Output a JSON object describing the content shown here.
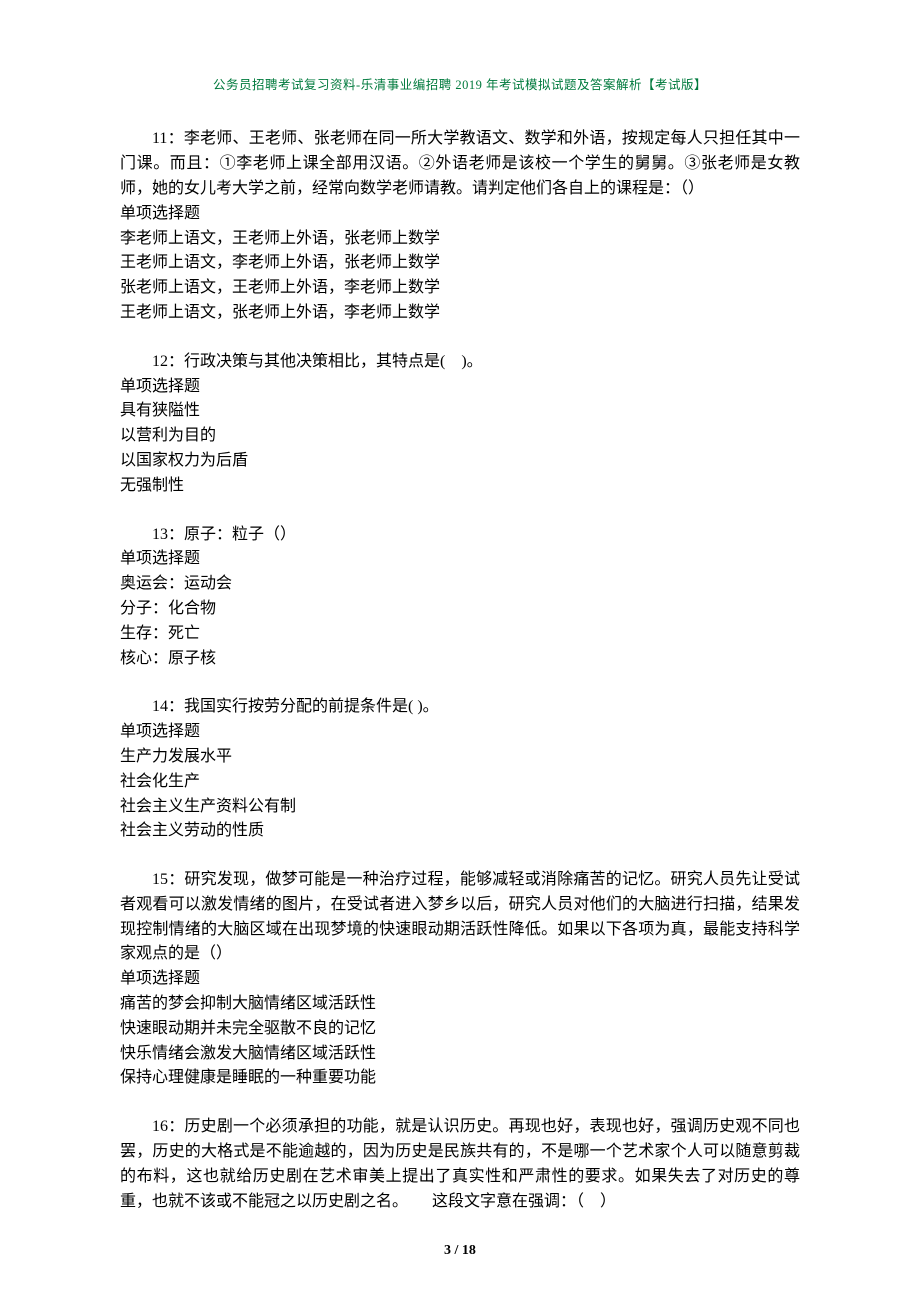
{
  "header": "公务员招聘考试复习资料-乐清事业编招聘 2019 年考试模拟试题及答案解析【考试版】",
  "footer": "3 / 18",
  "questions": [
    {
      "stem": "11：李老师、王老师、张老师在同一所大学教语文、数学和外语，按规定每人只担任其中一门课。而且：①李老师上课全部用汉语。②外语老师是该校一个学生的舅舅。③张老师是女教师，她的女儿考大学之前，经常向数学老师请教。请判定他们各自上的课程是：（）",
      "sub": "单项选择题",
      "options": [
        "李老师上语文，王老师上外语，张老师上数学",
        "王老师上语文，李老师上外语，张老师上数学",
        "张老师上语文，王老师上外语，李老师上数学",
        "王老师上语文，张老师上外语，李老师上数学"
      ]
    },
    {
      "stem": "12：行政决策与其他决策相比，其特点是(　)。",
      "sub": "单项选择题",
      "options": [
        "具有狭隘性",
        "以营利为目的",
        "以国家权力为后盾",
        "无强制性"
      ]
    },
    {
      "stem": "13：原子：粒子（）",
      "sub": "单项选择题",
      "options": [
        "奥运会：运动会",
        "分子：化合物",
        "生存：死亡",
        "核心：原子核"
      ]
    },
    {
      "stem": "14：我国实行按劳分配的前提条件是( )。",
      "sub": "单项选择题",
      "options": [
        "生产力发展水平",
        "社会化生产",
        "社会主义生产资料公有制",
        "社会主义劳动的性质"
      ]
    },
    {
      "stem": "15：研究发现，做梦可能是一种治疗过程，能够减轻或消除痛苦的记忆。研究人员先让受试者观看可以激发情绪的图片，在受试者进入梦乡以后，研究人员对他们的大脑进行扫描，结果发现控制情绪的大脑区域在出现梦境的快速眼动期活跃性降低。如果以下各项为真，最能支持科学家观点的是（）",
      "sub": "单项选择题",
      "options": [
        "痛苦的梦会抑制大脑情绪区域活跃性",
        "快速眼动期并未完全驱散不良的记忆",
        "快乐情绪会激发大脑情绪区域活跃性",
        "保持心理健康是睡眠的一种重要功能"
      ]
    },
    {
      "stem": "16：历史剧一个必须承担的功能，就是认识历史。再现也好，表现也好，强调历史观不同也罢，历史的大格式是不能逾越的，因为历史是民族共有的，不是哪一个艺术家个人可以随意剪裁的布料，这也就给历史剧在艺术审美上提出了真实性和严肃性的要求。如果失去了对历史的尊重，也就不该或不能冠之以历史剧之名。　　这段文字意在强调：（　）",
      "sub": "",
      "options": []
    }
  ]
}
